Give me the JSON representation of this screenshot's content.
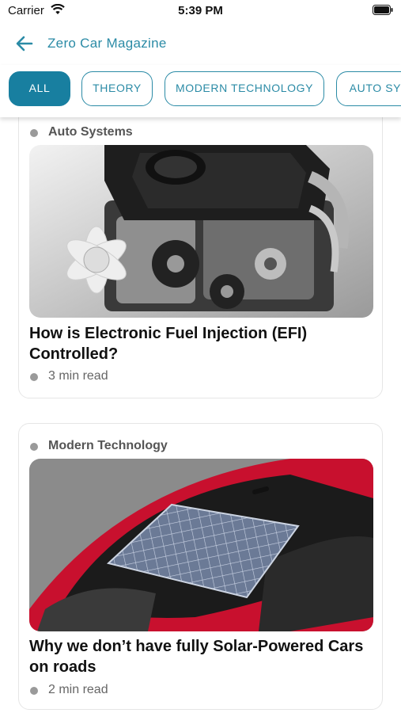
{
  "status_bar": {
    "carrier": "Carrier",
    "time": "5:39 PM"
  },
  "header": {
    "title": "Zero Car Magazine",
    "back_icon": "arrow-left-icon"
  },
  "tabs": [
    {
      "label": "ALL",
      "active": true
    },
    {
      "label": "THEORY",
      "active": false
    },
    {
      "label": "MODERN TECHNOLOGY",
      "active": false
    },
    {
      "label": "AUTO SYSTEMS",
      "active": false
    }
  ],
  "articles": [
    {
      "category": "Auto Systems",
      "title": "How is Electronic Fuel Injection (EFI) Controlled?",
      "read_time": "3 min read",
      "image": "engine-photo"
    },
    {
      "category": "Modern Technology",
      "title": "Why we don’t have fully Solar-Powered Cars on roads",
      "read_time": "2  min read",
      "image": "solar-roof-car-photo"
    }
  ],
  "colors": {
    "accent": "#2b8ba6",
    "tab_active_bg": "#187fa0",
    "card_border": "#e6e6e6",
    "meta_dot": "#9a9a9a"
  }
}
